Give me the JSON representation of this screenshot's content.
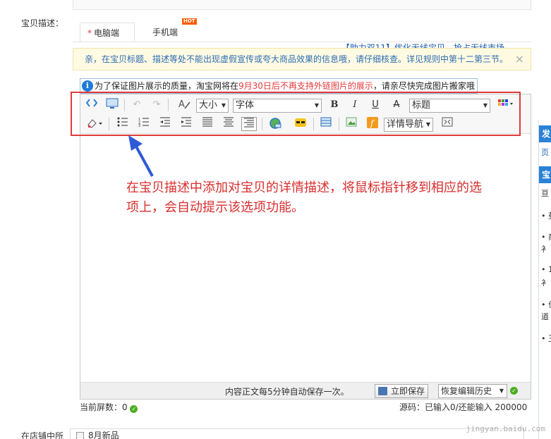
{
  "form": {
    "description_label": "宝贝描述：",
    "shop_label": "在店铺中所",
    "shop_option": "8月新品"
  },
  "tabs": {
    "pc": "电脑端",
    "pc_marker": "*",
    "mobile": "手机端",
    "hot_badge": "HOT"
  },
  "promo": "【助力双11】优化无线宝贝，抢占无线市场",
  "notice": {
    "text": "亲，在宝贝标题、描述等处不能出现虚假宣传或夸大商品效果的信息哦，请仔细核查。详见规则中第十二第三节。",
    "close": "×"
  },
  "image_notice": {
    "prefix": "为了保证图片展示的质量，淘宝网将在",
    "highlight": "9月30日后不再支持外链图片的展示",
    "suffix": "，请亲尽快完成图片搬家哦"
  },
  "toolbar": {
    "size_label": "大小",
    "font_label": "字体",
    "heading_label": "标题",
    "nav_label": "详情导航",
    "bold": "B",
    "italic": "I",
    "underline": "U",
    "strike": "A"
  },
  "annotation": {
    "line1": "在宝贝描述中添加对宝贝的详情描述，将鼠标指针移到相应的选",
    "line2": "项上，会自动提示该选项功能。"
  },
  "statusbar": {
    "autosave": "内容正文每5分钟自动保存一次。",
    "save": "立即保存",
    "history": "恢复编辑历史"
  },
  "footer": {
    "screens": "当前屏数：0",
    "source": "源码：已输入0/还能输入 200000"
  },
  "right_panel": {
    "head1": "发",
    "link": "页",
    "head2": "宝",
    "items": [
      "亘",
      "• 莬",
      "• 商",
      "衤",
      "• 1",
      "衤",
      "• 仁",
      "道",
      "• 王"
    ]
  },
  "watermark": "jingyan.baidu.com",
  "colors": {
    "accent": "#2a82d6",
    "highlight_red": "#e13a3a",
    "annotation_red": "#d82e2e",
    "arrow_blue": "#2e5ad6",
    "notice_bg": "#fffbe3"
  }
}
